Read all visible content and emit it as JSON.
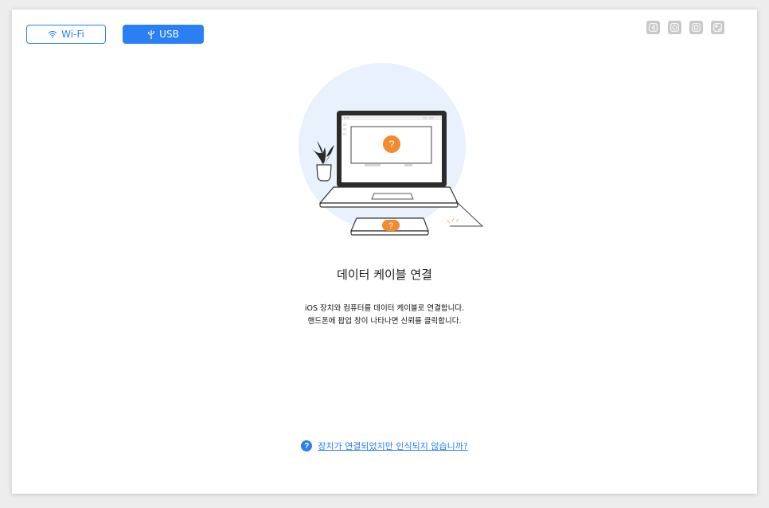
{
  "connection_modes": {
    "wifi_label": "Wi-Fi",
    "usb_label": "USB",
    "selected": "USB"
  },
  "window_controls": [
    {
      "icon": "back-icon"
    },
    {
      "icon": "circle-icon"
    },
    {
      "icon": "square-icon"
    },
    {
      "icon": "screenshot-icon"
    }
  ],
  "main": {
    "title": "데이터 케이블 연결",
    "description_line1": "iOS 장치와 컴퓨터를 데이터 케이블로 연결합니다.",
    "description_line2": "핸드폰에 팝업 창이 나타나면 신뢰를 클릭합니다."
  },
  "help": {
    "icon_glyph": "?",
    "link_text": "장치가 연결되었지만 인식되지 않습니까?"
  },
  "colors": {
    "accent": "#2a7ff5",
    "question_badge": "#f58a2d",
    "illustration_bg": "#e8f1fc"
  }
}
